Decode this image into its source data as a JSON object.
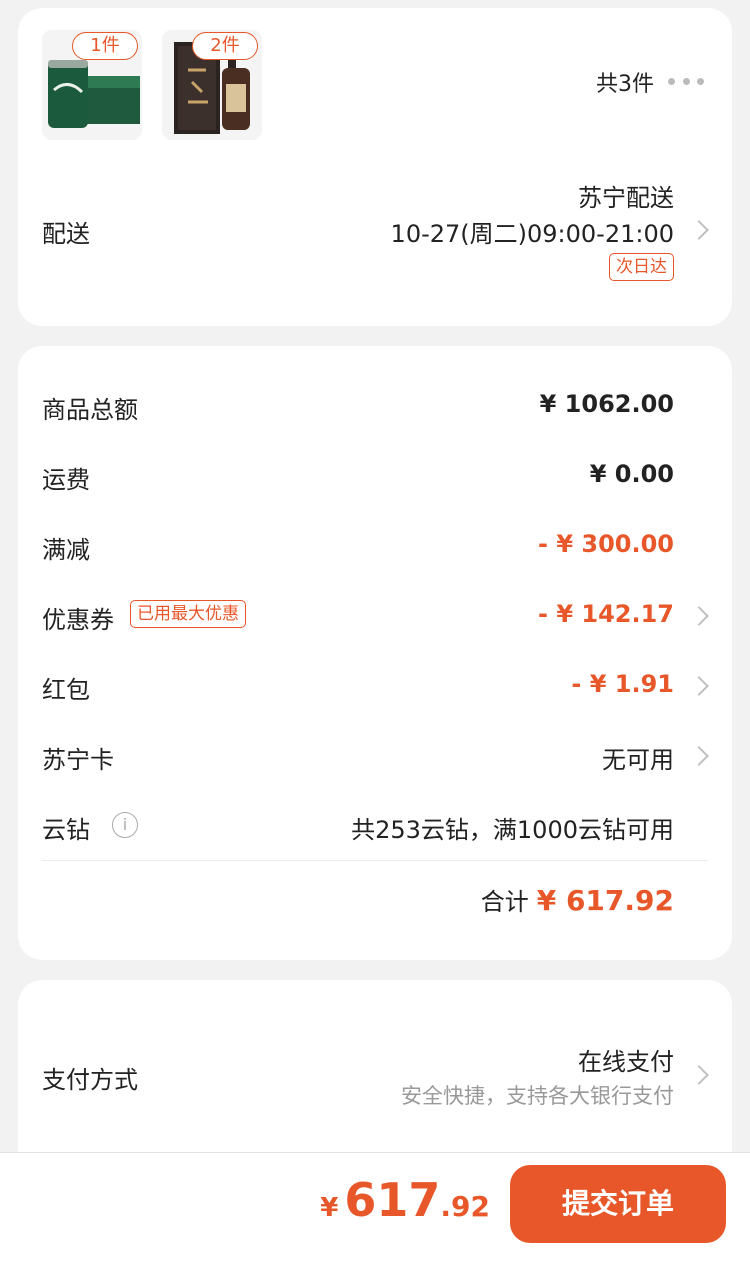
{
  "items": {
    "products": [
      {
        "qty_label": "1件",
        "icon": "beer-can-product-image"
      },
      {
        "qty_label": "2件",
        "icon": "liquor-bottle-product-image"
      }
    ],
    "total_label": "共3件",
    "delivery": {
      "label": "配送",
      "provider": "苏宁配送",
      "time": "10-27(周二)09:00-21:00",
      "tag": "次日达"
    }
  },
  "price": {
    "rows": [
      {
        "label": "商品总额",
        "value": "¥ 1062.00"
      },
      {
        "label": "运费",
        "value": "¥ 0.00"
      },
      {
        "label": "满减",
        "value": "- ¥ 300.00"
      },
      {
        "label": "优惠券",
        "tag": "已用最大优惠",
        "value": "- ¥ 142.17"
      },
      {
        "label": "红包",
        "value": "- ¥ 1.91"
      },
      {
        "label": "苏宁卡",
        "value": "无可用"
      },
      {
        "label": "云钻",
        "value": "共253云钻，满1000云钻可用"
      }
    ],
    "total_label": "合计",
    "total_value": "¥ 617.92"
  },
  "payment": {
    "label": "支付方式",
    "method": "在线支付",
    "sub": "安全快捷，支持各大银行支付"
  },
  "bottom": {
    "symbol": "¥",
    "int": "617",
    "dec": ".92",
    "submit": "提交订单"
  },
  "colors": {
    "accent": "#e8572a",
    "background": "#f2f2f2"
  }
}
